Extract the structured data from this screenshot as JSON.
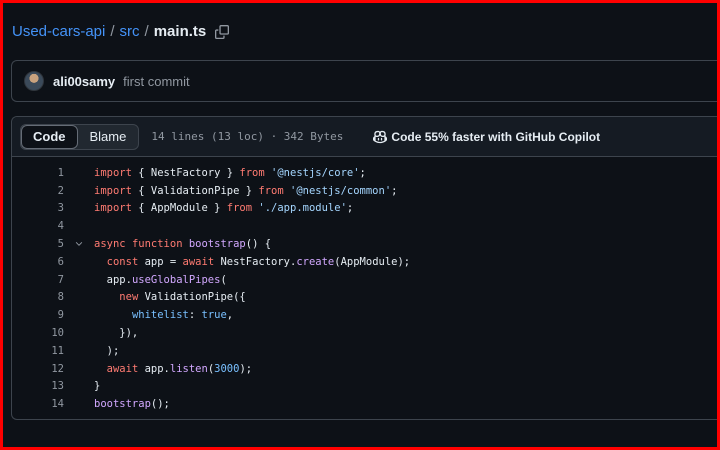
{
  "breadcrumb": {
    "repo": "Used-cars-api",
    "separator": "/",
    "dir": "src",
    "file": "main.ts"
  },
  "commit": {
    "author": "ali00samy",
    "message": "first commit"
  },
  "file_header": {
    "tabs": [
      "Code",
      "Blame"
    ],
    "active_tab": "Code",
    "info": "14 lines (13 loc) · 342 Bytes",
    "copilot": "Code 55% faster with GitHub Copilot"
  },
  "code": {
    "language": "typescript",
    "line_numbers": [
      "1",
      "2",
      "3",
      "4",
      "5",
      "6",
      "7",
      "8",
      "9",
      "10",
      "11",
      "12",
      "13",
      "14"
    ],
    "lines": [
      "import { NestFactory } from '@nestjs/core';",
      "import { ValidationPipe } from '@nestjs/common';",
      "import { AppModule } from './app.module';",
      "",
      "async function bootstrap() {",
      "  const app = await NestFactory.create(AppModule);",
      "  app.useGlobalPipes(",
      "    new ValidationPipe({",
      "      whitelist: true,",
      "    }),",
      "  );",
      "  await app.listen(3000);",
      "}",
      "bootstrap();"
    ]
  },
  "colors": {
    "background": "#0d1117",
    "link": "#4493f8",
    "keyword": "#ff7b72",
    "string": "#a5d6ff",
    "function": "#d2a8ff",
    "constant": "#79c0ff",
    "frame": "#ff0000"
  },
  "icons": {
    "copy": "copy-icon",
    "copilot": "copilot-icon",
    "fold": "chevron-down-icon"
  }
}
